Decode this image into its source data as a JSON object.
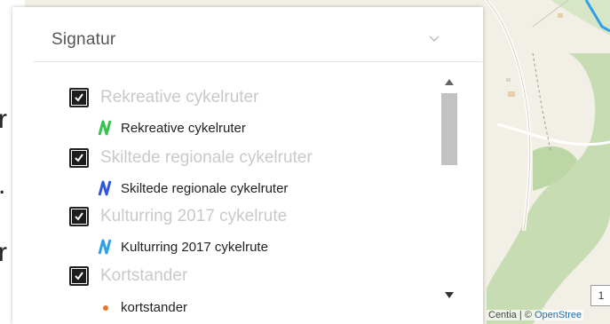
{
  "panel": {
    "title": "Signatur"
  },
  "legend_groups": [
    {
      "label": "Rekreative cykelruter",
      "checked": true,
      "symbol": "cycle-route-icon",
      "symbol_color": "#34c24a",
      "item": "Rekreative cykelruter"
    },
    {
      "label": "Skiltede regionale cykelruter",
      "checked": true,
      "symbol": "cycle-route-icon",
      "symbol_color": "#2f56e0",
      "item": "Skiltede regionale cykelruter"
    },
    {
      "label": "Kulturring 2017 cykelrute",
      "checked": true,
      "symbol": "cycle-route-icon",
      "symbol_color": "#2aa0e8",
      "item": "Kulturring 2017 cykelrute"
    },
    {
      "label": "Kortstander",
      "checked": true,
      "symbol": "dot-icon",
      "symbol_color": "#e8752a",
      "item": "kortstander"
    }
  ],
  "map": {
    "left_labels": [
      "r",
      ".",
      "r"
    ],
    "attribution_prefix": "Centia | © ",
    "attribution_link": "OpenStree",
    "scale_box": "1"
  }
}
